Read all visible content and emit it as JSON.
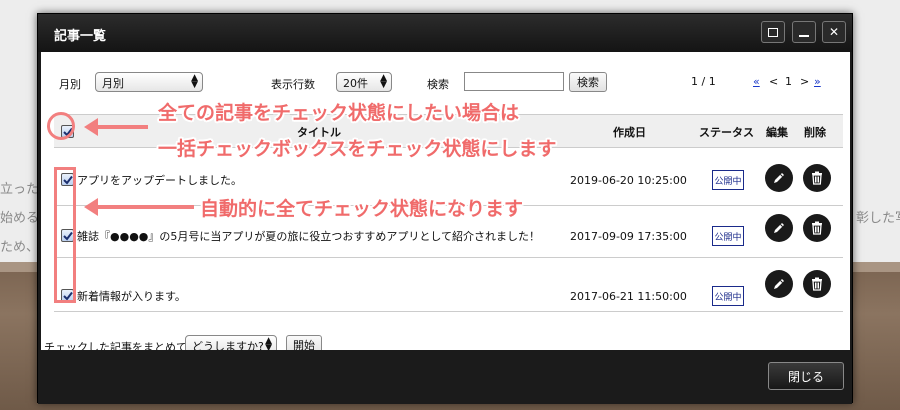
{
  "background": {
    "text_left": [
      "立った",
      "始める",
      "ため、"
    ],
    "text_right": "彰した写"
  },
  "modal": {
    "title": "記事一覧",
    "close_label": "閉じる"
  },
  "filters": {
    "month_label": "月別",
    "month_value": "月別",
    "rows_label": "表示行数",
    "rows_value": "20件",
    "search_label": "検索",
    "search_value": "",
    "search_button": "検索"
  },
  "pager": {
    "status": "1 / 1",
    "first": "«",
    "prev": "<",
    "current": "1",
    "next": ">",
    "last": "»"
  },
  "table": {
    "headers": {
      "title": "タイトル",
      "date": "作成日",
      "status": "ステータス",
      "edit": "編集",
      "delete": "削除"
    },
    "rows": [
      {
        "title": "アプリをアップデートしました。",
        "date": "2019-06-20 10:25:00",
        "status": "公開中",
        "checked": true
      },
      {
        "title": "雑誌『●●●●』の5月号に当アプリが夏の旅に役立つおすすめアプリとして紹介されました！",
        "date": "2017-09-09 17:35:00",
        "status": "公開中",
        "checked": true
      },
      {
        "title": "新着情報が入ります。",
        "date": "2017-06-21 11:50:00",
        "status": "公開中",
        "checked": true
      }
    ]
  },
  "bulk": {
    "label": "チェックした記事をまとめて",
    "select_value": "どうしますか?",
    "start_button": "開始"
  },
  "annotations": {
    "line1": "全ての記事をチェック状態にしたい場合は",
    "line2": "一括チェックボックスをチェック状態にします",
    "line3": "自動的に全てチェック状態になります"
  },
  "colors": {
    "annotation": "#f06b6b",
    "status_badge": "#1a2a8a",
    "link": "#1a38c9"
  }
}
